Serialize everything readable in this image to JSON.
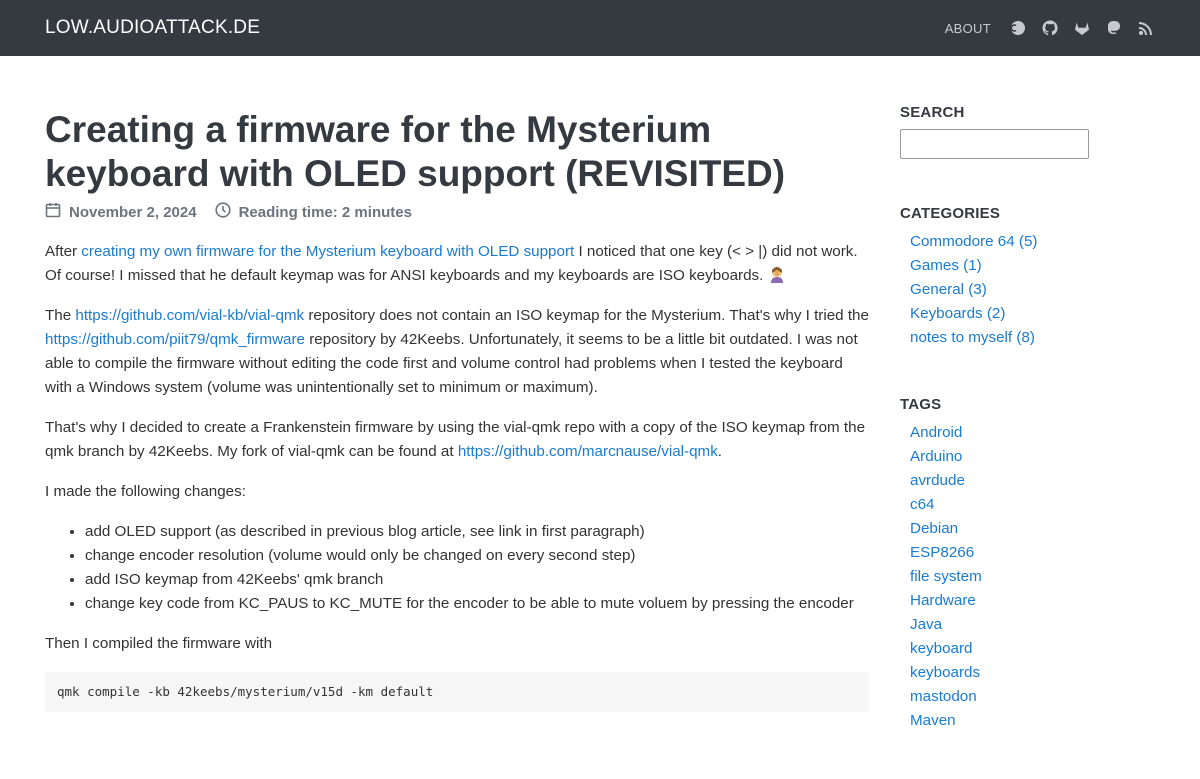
{
  "nav": {
    "brand": "LOW.AUDIOATTACK.DE",
    "about": "ABOUT",
    "icons": [
      "cc-icon",
      "github-icon",
      "gitlab-icon",
      "mastodon-icon",
      "rss-icon"
    ]
  },
  "post": {
    "title": "Creating a firmware for the Mysterium keyboard with OLED support (REVISITED)",
    "date": "November 2, 2024",
    "reading_time": "Reading time: 2 minutes",
    "p1_pre": "After ",
    "p1_link": "creating my own firmware for the Mysterium keyboard with OLED support",
    "p1_post": " I noticed that one key (< > |) did not work. Of course! I missed that he default keymap was for ANSI keyboards and my keyboards are ISO keyboards.",
    "p2_a": "The ",
    "p2_link1": "https://github.com/vial-kb/vial-qmk",
    "p2_b": " repository does not contain an ISO keymap for the Mysterium. That's why I tried the ",
    "p2_link2": "https://github.com/piit79/qmk_firmware",
    "p2_c": " repository by 42Keebs. Unfortunately, it seems to be a little bit outdated. I was not able to compile the firmware without editing the code first and volume control had problems when I tested the keyboard with a Windows system (volume was unintentionally set to minimum or maximum).",
    "p3_a": "That's why I decided to create a Frankenstein firmware by using the vial-qmk repo with a copy of the ISO keymap from the qmk branch by 42Keebs. My fork of vial-qmk can be found at ",
    "p3_link": "https://github.com/marcnause/vial-qmk",
    "p3_b": ".",
    "p4": "I made the following changes:",
    "changes": [
      "add OLED support (as described in previous blog article, see link in first paragraph)",
      "change encoder resolution (volume would only be changed on every second step)",
      "add ISO keymap from 42Keebs' qmk branch",
      "change key code from KC_PAUS to KC_MUTE for the encoder to be able to mute voluem by pressing the encoder"
    ],
    "p5": "Then I compiled the firmware with",
    "code": "qmk compile -kb 42keebs/mysterium/v15d -km default"
  },
  "sidebar": {
    "search_heading": "SEARCH",
    "categories_heading": "CATEGORIES",
    "categories": [
      "Commodore 64 (5)",
      "Games (1)",
      "General (3)",
      "Keyboards (2)",
      "notes to myself (8)"
    ],
    "tags_heading": "TAGS",
    "tags": [
      "Android",
      "Arduino",
      "avrdude",
      "c64",
      "Debian",
      "ESP8266",
      "file system",
      "Hardware",
      "Java",
      "keyboard",
      "keyboards",
      "mastodon",
      "Maven"
    ]
  }
}
